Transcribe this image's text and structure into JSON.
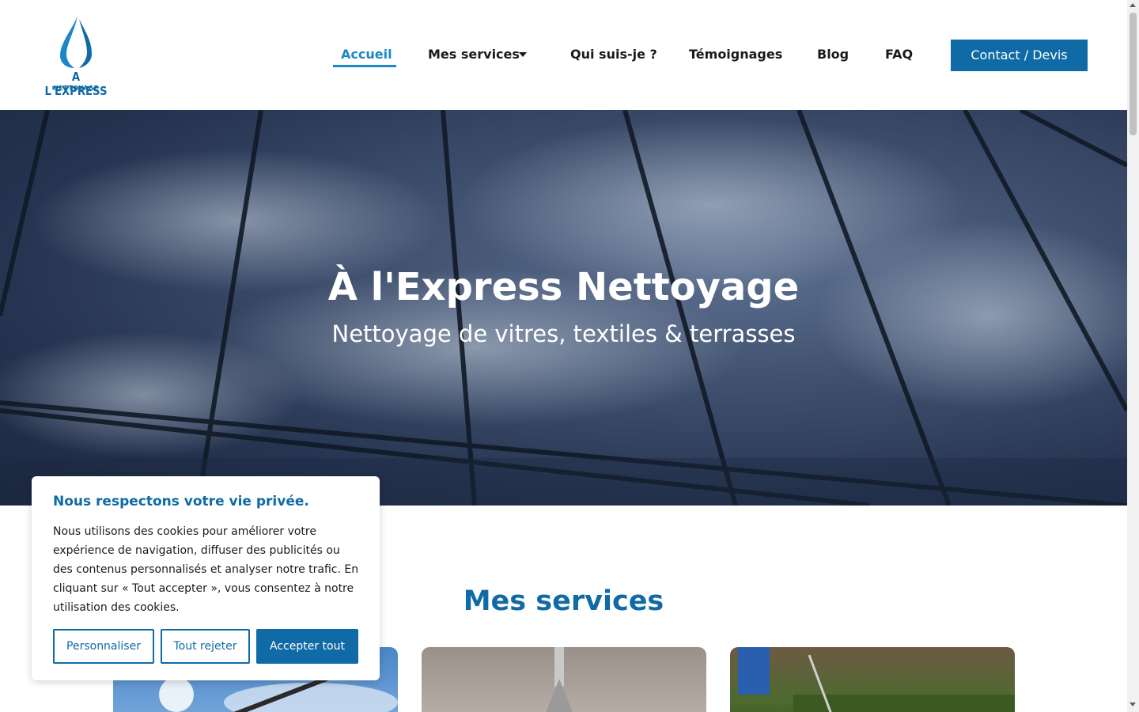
{
  "header": {
    "logo": {
      "line1": "A L'EXPRESS",
      "line2": "NETTOYAGE"
    },
    "nav": [
      {
        "label": "Accueil",
        "active": true
      },
      {
        "label": "Mes services",
        "has_dropdown": true
      },
      {
        "label": "Qui suis-je ?"
      },
      {
        "label": "Témoignages"
      },
      {
        "label": "Blog"
      },
      {
        "label": "FAQ"
      }
    ],
    "contact_button": "Contact / Devis"
  },
  "hero": {
    "title": "À l'Express Nettoyage",
    "subtitle": "Nettoyage de vitres, textiles & terrasses"
  },
  "services": {
    "title": "Mes services",
    "cards": [
      {
        "image": "window-cleaning-photo"
      },
      {
        "image": "sofa-cleaning-photo"
      },
      {
        "image": "terrace-pressure-washing-photo"
      }
    ]
  },
  "cookie_banner": {
    "title": "Nous respectons votre vie privée.",
    "text": "Nous utilisons des cookies pour améliorer votre expérience de navigation, diffuser des publicités ou des contenus personnalisés et analyser notre trafic. En cliquant sur « Tout accepter », vous consentez à notre utilisation des cookies.",
    "buttons": {
      "customize": "Personnaliser",
      "reject": "Tout rejeter",
      "accept": "Accepter tout"
    }
  },
  "colors": {
    "brand": "#0f6aa5",
    "nav_active": "#1b87c7",
    "text": "#1a1a1a"
  }
}
